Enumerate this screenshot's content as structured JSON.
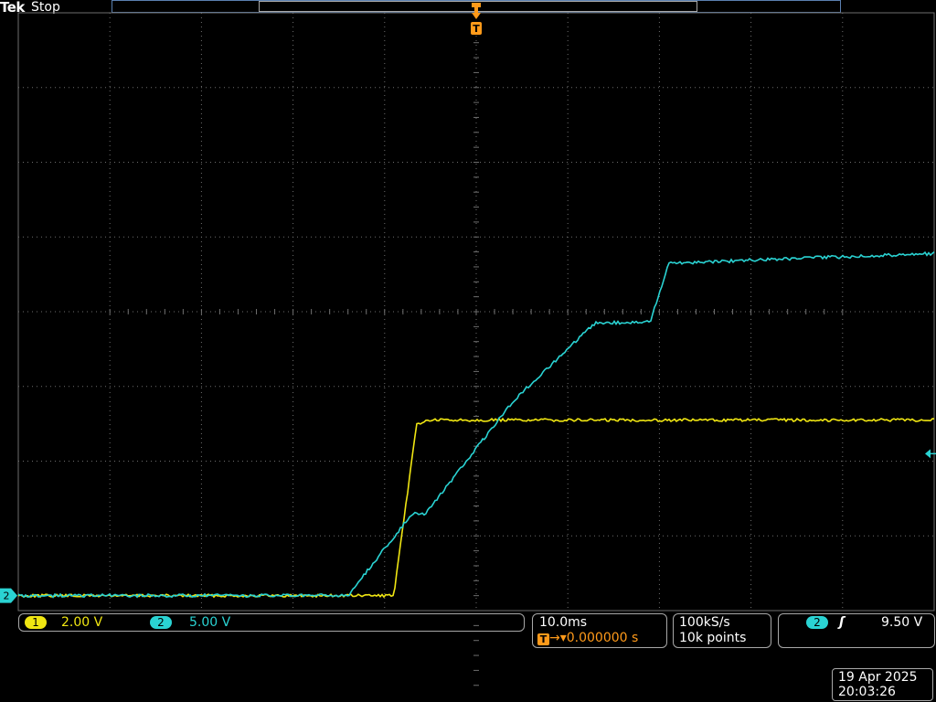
{
  "header": {
    "brand": "Tek",
    "status": "Stop"
  },
  "trigger_marker_label": "T",
  "channels": [
    {
      "label": "1",
      "scale": "2.00 V",
      "color": "#f0e612"
    },
    {
      "label": "2",
      "scale": "5.00 V",
      "color": "#2ad3d3"
    }
  ],
  "horizontal": {
    "timebase": "10.0ms",
    "trigger_icon": "T",
    "trigger_position": "→▾0.000000 s"
  },
  "acquisition": {
    "sample_rate": "100kS/s",
    "record_length": "10k points"
  },
  "trigger": {
    "source": "2",
    "slope_icon": "rising-edge-icon",
    "slope_glyph": "ʃ",
    "level": "9.50 V"
  },
  "datetime": {
    "date": "19 Apr 2025",
    "time": "20:03:26"
  },
  "colors": {
    "ch1": "#f0e612",
    "ch2": "#2ad3d3",
    "trigger": "#ff9a1a",
    "grid": "#6e6e6e"
  },
  "chart_data": {
    "type": "line",
    "x_unit": "divisions",
    "y_unit": "divisions",
    "xlim": [
      -5,
      5
    ],
    "ylim": [
      -4,
      4
    ],
    "grid": true,
    "series": [
      {
        "x": [
          -5,
          -1.4,
          -0.9,
          -0.65,
          -0.5,
          0.3,
          5
        ],
        "y": [
          -3.8,
          -3.8,
          -3.8,
          -1.5,
          -1.45,
          -1.45,
          -1.45
        ]
      },
      {
        "x": [
          -5,
          -1.4,
          -0.7,
          -0.55,
          0.4,
          1.3,
          1.9,
          2.1,
          5
        ],
        "y": [
          -3.8,
          -3.8,
          -2.7,
          -2.7,
          -1.2,
          -0.15,
          -0.14,
          0.65,
          0.78
        ]
      }
    ]
  }
}
